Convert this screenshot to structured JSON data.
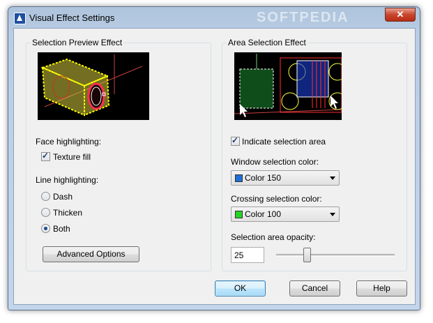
{
  "window": {
    "title": "Visual Effect Settings",
    "close_glyph": "✕",
    "watermark": "SOFTPEDIA"
  },
  "preview_group": {
    "label": "Selection Preview Effect"
  },
  "face_highlighting": {
    "label": "Face highlighting:",
    "texture_fill": {
      "label": "Texture fill",
      "checked": true
    }
  },
  "line_highlighting": {
    "label": "Line highlighting:",
    "options": [
      {
        "label": "Dash",
        "selected": false
      },
      {
        "label": "Thicken",
        "selected": false
      },
      {
        "label": "Both",
        "selected": true
      }
    ]
  },
  "advanced_button": "Advanced Options",
  "area_group": {
    "label": "Area Selection Effect",
    "indicate": {
      "label": "Indicate selection area",
      "checked": true
    },
    "window_color": {
      "label": "Window selection color:",
      "value": "Color 150",
      "swatch": "#1f6fd6"
    },
    "crossing_color": {
      "label": "Crossing selection color:",
      "value": "Color 100",
      "swatch": "#26d426"
    },
    "opacity": {
      "label": "Selection area opacity:",
      "value": "25",
      "percent": 25
    }
  },
  "buttons": {
    "ok": "OK",
    "cancel": "Cancel",
    "help": "Help"
  }
}
